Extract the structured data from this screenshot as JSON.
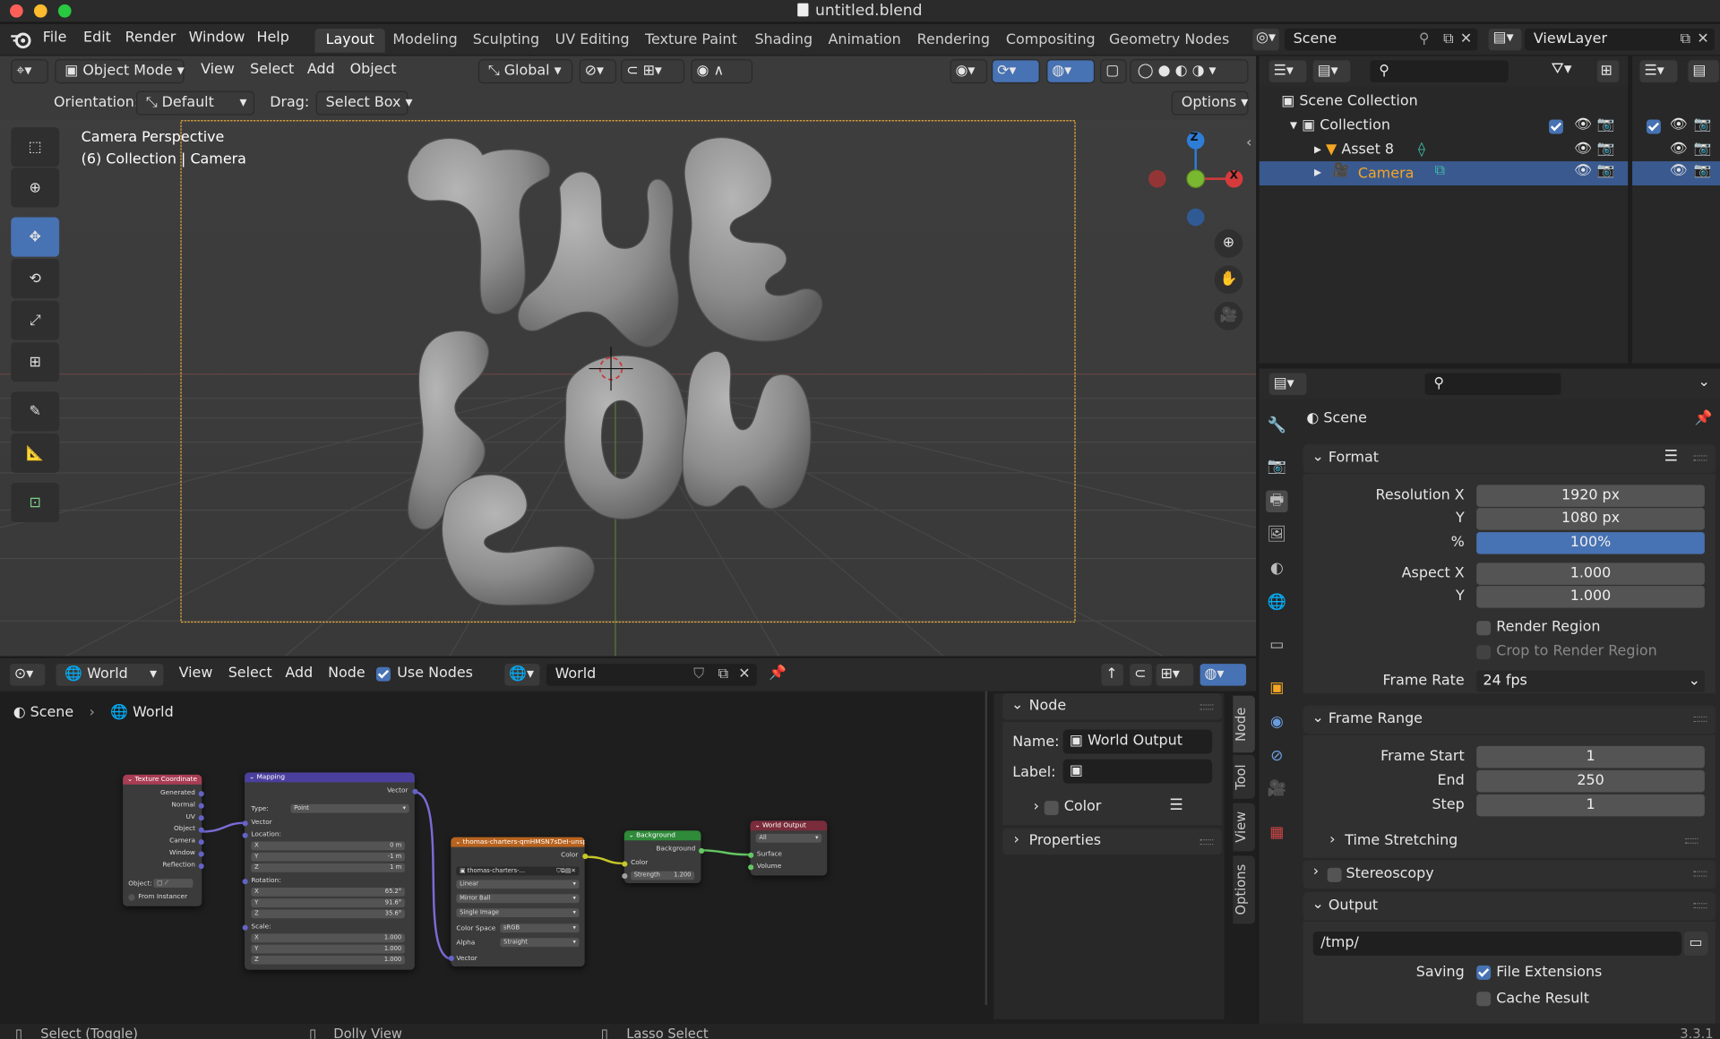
{
  "window": {
    "title": "untitled.blend"
  },
  "menu": [
    "File",
    "Edit",
    "Render",
    "Window",
    "Help"
  ],
  "workspaces": [
    "Layout",
    "Modeling",
    "Sculpting",
    "UV Editing",
    "Texture Paint",
    "Shading",
    "Animation",
    "Rendering",
    "Compositing",
    "Geometry Nodes"
  ],
  "scene_selector": {
    "scene": "Scene",
    "view_layer": "ViewLayer"
  },
  "viewport_header": {
    "mode": "Object Mode",
    "menus": [
      "View",
      "Select",
      "Add",
      "Object"
    ],
    "transform": "Global"
  },
  "tool_settings": {
    "orientation_label": "Orientation:",
    "orientation": "Default",
    "drag_label": "Drag:",
    "drag": "Select Box",
    "options": "Options"
  },
  "viewport": {
    "line1": "Camera Perspective",
    "line2": "(6) Collection | Camera",
    "gizmo": {
      "z": "Z",
      "x": "X"
    }
  },
  "outliner": {
    "root": "Scene Collection",
    "collection": "Collection",
    "items": [
      {
        "name": "Asset 8"
      },
      {
        "name": "Camera"
      }
    ]
  },
  "node_editor": {
    "header": {
      "type": "World",
      "menus": [
        "View",
        "Select",
        "Add",
        "Node"
      ],
      "use_nodes": "Use Nodes",
      "world": "World"
    },
    "breadcrumb": {
      "scene": "Scene",
      "world": "World"
    },
    "nodes": {
      "texcoord": {
        "title": "Texture Coordinate",
        "outputs": [
          "Generated",
          "Normal",
          "UV",
          "Object",
          "Camera",
          "Window",
          "Reflection"
        ],
        "object_label": "Object:",
        "instancer": "From Instancer"
      },
      "mapping": {
        "title": "Mapping",
        "output": "Vector",
        "type_label": "Type:",
        "type": "Point",
        "vector": "Vector",
        "location": "Location:",
        "loc": [
          [
            "X",
            "0 m"
          ],
          [
            "Y",
            "-1 m"
          ],
          [
            "Z",
            "1 m"
          ]
        ],
        "rotation": "Rotation:",
        "rot": [
          [
            "X",
            "65.2°"
          ],
          [
            "Y",
            "91.6°"
          ],
          [
            "Z",
            "35.6°"
          ]
        ],
        "scale": "Scale:",
        "scl": [
          [
            "X",
            "1.000"
          ],
          [
            "Y",
            "1.000"
          ],
          [
            "Z",
            "1.000"
          ]
        ]
      },
      "image": {
        "title": "thomas-charters-qmHMSN7sDeI-unsplas..",
        "output": "Color",
        "file": "thomas-charters-...",
        "interp": "Linear",
        "proj": "Mirror Ball",
        "source": "Single Image",
        "cs_label": "Color Space",
        "cs": "sRGB",
        "alpha_label": "Alpha",
        "alpha": "Straight",
        "input": "Vector"
      },
      "background": {
        "title": "Background",
        "output": "Background",
        "color": "Color",
        "strength_label": "Strength",
        "strength": "1.200"
      },
      "output": {
        "title": "World Output",
        "target": "All",
        "surface": "Surface",
        "volume": "Volume"
      }
    },
    "sidebar": {
      "node_header": "Node",
      "name_label": "Name:",
      "name": "World Output",
      "label_label": "Label:",
      "color": "Color",
      "properties": "Properties"
    },
    "tabs": [
      "Node",
      "Tool",
      "View",
      "Options"
    ]
  },
  "properties": {
    "context": "Scene",
    "format": {
      "header": "Format",
      "res_x_label": "Resolution X",
      "res_x": "1920 px",
      "res_y_label": "Y",
      "res_y": "1080 px",
      "pct_label": "%",
      "pct": "100%",
      "pct_value": 1.0,
      "asp_x_label": "Aspect X",
      "asp_x": "1.000",
      "asp_y_label": "Y",
      "asp_y": "1.000",
      "render_region": "Render Region",
      "crop": "Crop to Render Region",
      "frame_rate_label": "Frame Rate",
      "frame_rate": "24 fps"
    },
    "frame_range": {
      "header": "Frame Range",
      "start_label": "Frame Start",
      "start": "1",
      "end_label": "End",
      "end": "250",
      "step_label": "Step",
      "step": "1",
      "time_stretching": "Time Stretching"
    },
    "stereoscopy": "Stereoscopy",
    "output": {
      "header": "Output",
      "path": "/tmp/",
      "saving_label": "Saving",
      "file_ext": "File Extensions",
      "cache": "Cache Result"
    }
  },
  "statusbar": {
    "left": "Select (Toggle)",
    "mid": "Dolly View",
    "right": "Lasso Select",
    "version": "3.3.1"
  },
  "colors": {
    "accent": "#4772b3",
    "active_object": "#f5a623",
    "camera_frame": "#e8a93a"
  }
}
